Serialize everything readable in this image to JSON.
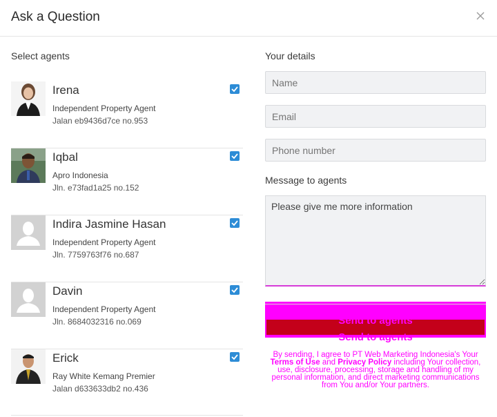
{
  "dialog": {
    "title": "Ask a Question"
  },
  "agents_section": {
    "label": "Select agents",
    "agents": [
      {
        "name": "Irena",
        "company": "Independent Property Agent",
        "address": "Jalan eb9436d7ce no.953",
        "selected": true
      },
      {
        "name": "Iqbal",
        "company": "Apro Indonesia",
        "address": "Jln. e73fad1a25 no.152",
        "selected": true
      },
      {
        "name": "Indira Jasmine Hasan",
        "company": "Independent Property Agent",
        "address": "Jln. 7759763f76 no.687",
        "selected": true
      },
      {
        "name": "Davin",
        "company": "Independent Property Agent",
        "address": "Jln. 8684032316 no.069",
        "selected": true
      },
      {
        "name": "Erick",
        "company": "Ray White Kemang Premier",
        "address": "Jalan d633633db2 no.436",
        "selected": true
      }
    ]
  },
  "details": {
    "label": "Your details",
    "name_placeholder": "Name",
    "email_placeholder": "Email",
    "phone_placeholder": "Phone number",
    "message_label": "Message to agents",
    "message_value": "Please give me more information"
  },
  "send": {
    "label": "Send to agents"
  },
  "terms": {
    "prefix": "By sending, I agree to PT Web Marketing Indonesia's Your",
    "terms_link": "Terms of Use",
    "and": "and",
    "privacy_link": "Privacy Policy",
    "suffix": "including Your collection, use, disclosure, processing, storage and handling of my personal information, and direct marketing communications from You and/or Your partners."
  },
  "colors": {
    "accent": "#2d8cd6",
    "button_fill": "#ff00ff",
    "button_inner": "#c4001a"
  }
}
